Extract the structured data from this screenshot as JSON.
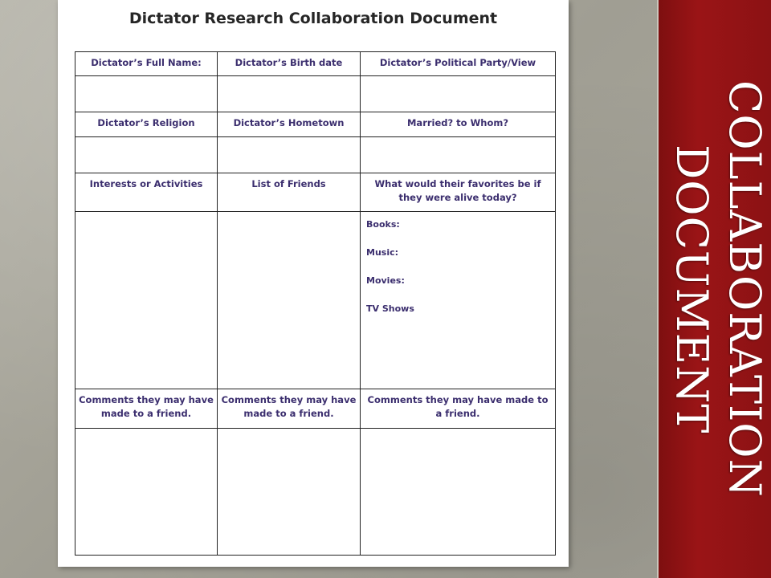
{
  "slide": {
    "title_line1": "Collaboration",
    "title_line2": "Document"
  },
  "document": {
    "title": "Dictator Research Collaboration Document",
    "row1_headers": [
      "Dictator’s Full Name:",
      "Dictator’s Birth date",
      "Dictator’s Political Party/View"
    ],
    "row2_headers": [
      "Dictator’s  Religion",
      "Dictator’s Hometown",
      "Married? to Whom?"
    ],
    "row3_headers": [
      "Interests or Activities",
      "List of Friends",
      "What would their favorites be if they were alive today?"
    ],
    "favorites": [
      "Books:",
      "Music:",
      "Movies:",
      "TV Shows"
    ],
    "row4_headers": [
      "Comments they may have made to a friend.",
      "Comments they may have made to a friend.",
      "Comments they may have made to a friend."
    ]
  },
  "colors": {
    "panel": "#8c1214",
    "header_text": "#3b2e6e"
  }
}
